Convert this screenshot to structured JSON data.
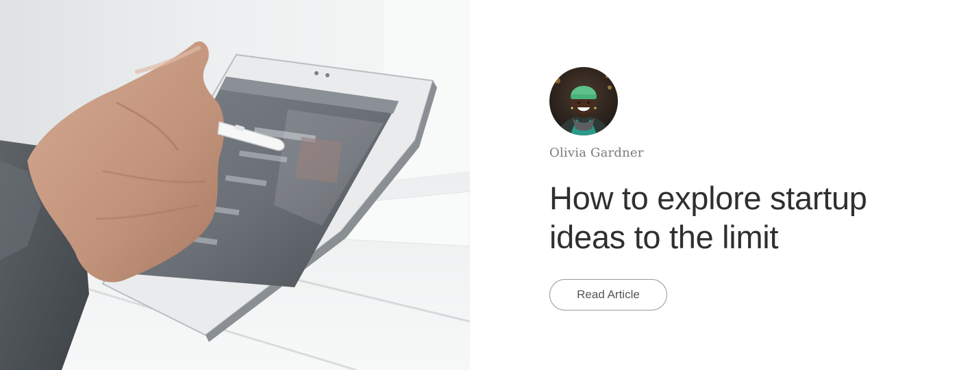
{
  "article": {
    "author": "Olivia Gardner",
    "title": "How to explore startup ideas to the limit",
    "cta_label": "Read Article"
  },
  "colors": {
    "title_text": "#2f2f2f",
    "author_text": "#7a7a7a",
    "button_border": "#9a9a9a",
    "button_text": "#555555",
    "background": "#ffffff"
  },
  "icons": {
    "hero_image": "tablet-with-stylus-photo",
    "avatar": "author-avatar-photo"
  }
}
